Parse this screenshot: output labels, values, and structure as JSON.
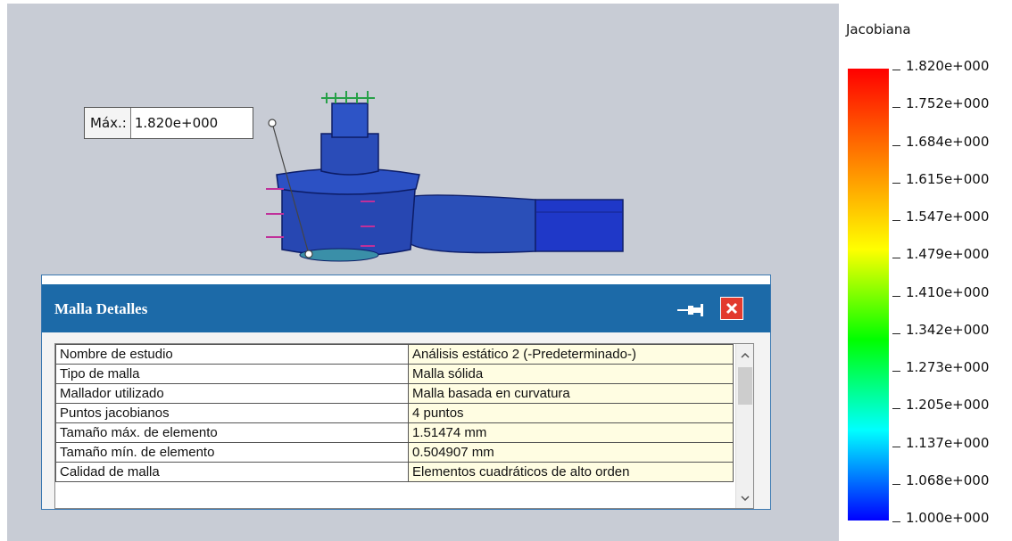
{
  "callout": {
    "label": "Máx.:",
    "value": "1.820e+000"
  },
  "legend": {
    "title": "Jacobiana",
    "labels": [
      "1.820e+000",
      "1.752e+000",
      "1.684e+000",
      "1.615e+000",
      "1.547e+000",
      "1.479e+000",
      "1.410e+000",
      "1.342e+000",
      "1.273e+000",
      "1.205e+000",
      "1.137e+000",
      "1.068e+000",
      "1.000e+000"
    ],
    "colors": [
      "#ff0000",
      "#ff8000",
      "#ffff00",
      "#00ff00",
      "#00ffff",
      "#0000ff"
    ]
  },
  "dialog": {
    "title": "Malla Detalles",
    "pin_icon": "pin-icon",
    "close_icon": "close-icon",
    "rows": [
      {
        "key": "Nombre de estudio",
        "value": "Análisis estático 2 (-Predeterminado-)"
      },
      {
        "key": "Tipo de malla",
        "value": "Malla sólida"
      },
      {
        "key": "Mallador utilizado",
        "value": "Malla basada en curvatura"
      },
      {
        "key": "Puntos jacobianos",
        "value": "4 puntos"
      },
      {
        "key": "Tamaño máx. de elemento",
        "value": "1.51474 mm"
      },
      {
        "key": "Tamaño mín. de elemento",
        "value": "0.504907 mm"
      },
      {
        "key": "Calidad de malla",
        "value": "Elementos cuadráticos de alto orden"
      }
    ]
  }
}
